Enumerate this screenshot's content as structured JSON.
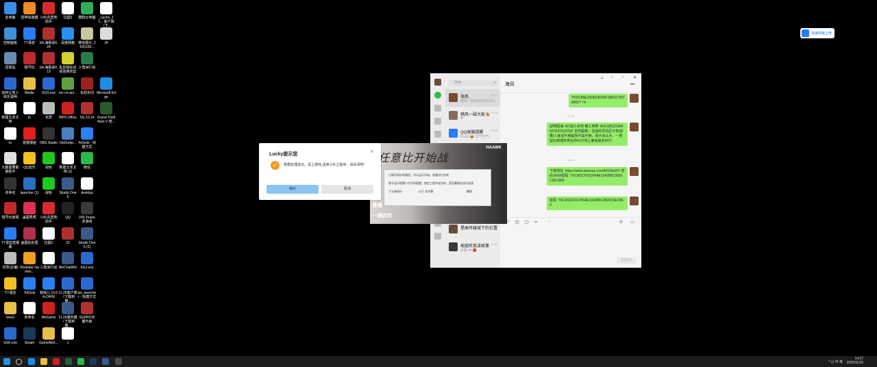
{
  "desktop_icons": [
    {
      "label": "此电脑",
      "color": "#3a8ee6"
    },
    {
      "label": "雷神加速器",
      "color": "#f08a24"
    },
    {
      "label": "小红花营地助手",
      "color": "#d92b2b"
    },
    {
      "label": "拉圆2",
      "color": "#ffffff"
    },
    {
      "label": "酷狗云电脑",
      "color": "#2fae5a"
    },
    {
      "label": "_cache_11... 客户端（下...",
      "color": "#ffffff"
    },
    {
      "label": "控制面板",
      "color": "#3d8fd6"
    },
    {
      "label": "TT语音",
      "color": "#2a7cf7"
    },
    {
      "label": "SA.海报桌6.24",
      "color": "#b03030"
    },
    {
      "label": "百度网盘",
      "color": "#2a90f0"
    },
    {
      "label": "微信图片_2025100...",
      "color": "#c8c8a0"
    },
    {
      "label": "JK",
      "color": "#dddddd"
    },
    {
      "label": "回收站",
      "color": "#6a8bb0"
    },
    {
      "label": "租号玩",
      "color": "#c02a2a"
    },
    {
      "label": "SA.海报桌6.19",
      "color": "#b03030"
    },
    {
      "label": "乱剪辑钻出体验果的剪",
      "color": "#d0d030"
    },
    {
      "label": "三角洲行动",
      "color": "#2a7a4a"
    },
    {
      "label": "如何让男人快乐说明",
      "color": "#2a6ad0"
    },
    {
      "label": "Media",
      "color": "#e8c048"
    },
    {
      "label": "SGS.exe",
      "color": "#2a6ad0"
    },
    {
      "label": "toc-cn-act...",
      "color": "#60a040"
    },
    {
      "label": "永劫无间",
      "color": "#a02020"
    },
    {
      "label": "Microsoft Edge",
      "color": "#1d8de0"
    },
    {
      "label": "新建文本文档",
      "color": "#ffffff"
    },
    {
      "label": "to",
      "color": "#ffffff"
    },
    {
      "label": "花草",
      "color": "#bbbbbb"
    },
    {
      "label": "WPS Office",
      "color": "#d02020"
    },
    {
      "label": "SU-10.14",
      "color": "#b03030"
    },
    {
      "label": "Grand Theft Auto V 增...",
      "color": "#2a5a2a"
    },
    {
      "label": "to",
      "color": "#ffffff"
    },
    {
      "label": "雷霆傳遊",
      "color": "#e02020"
    },
    {
      "label": "OBS Studio",
      "color": "#333333"
    },
    {
      "label": "GbDump...",
      "color": "#4a80c0"
    },
    {
      "label": "ToDesk - 快捷方式",
      "color": "#2a80f0"
    },
    {
      "label": "九趣需要勤勉助手",
      "color": "#e0e0e0"
    },
    {
      "label": "QQ音乐",
      "color": "#f0c020"
    },
    {
      "label": "绿色",
      "color": "#1ec81e"
    },
    {
      "label": "新建文本文档 (2)",
      "color": "#ffffff"
    },
    {
      "label": "微信",
      "color": "#2cb84c"
    },
    {
      "label": "未命名",
      "color": "#333333"
    },
    {
      "label": "launcher (1)",
      "color": "#2a70c0"
    },
    {
      "label": "绿色",
      "color": "#1ec81e"
    },
    {
      "label": "Studio One 6",
      "color": "#3a5a8a"
    },
    {
      "label": "desktop",
      "color": "#ffffff"
    },
    {
      "label": "租号玩家网",
      "color": "#c02a2a"
    },
    {
      "label": "盖图秀秀",
      "color": "#e03050"
    },
    {
      "label": "小红花营地助手",
      "color": "#d92b2b"
    },
    {
      "label": "QQ",
      "color": "#222222"
    },
    {
      "label": "240 2nano 贵游戏",
      "color": "#3a3a3a"
    },
    {
      "label": "TT语音直播版",
      "color": "#2a7cf7"
    },
    {
      "label": "盖图批处理",
      "color": "#b03050"
    },
    {
      "label": "拉圆1",
      "color": "#ffffff"
    },
    {
      "label": "22",
      "color": "#b03030"
    },
    {
      "label": "Studio One 6 (2)",
      "color": "#3a5a8a"
    },
    {
      "label": "花草(企编)",
      "color": "#bbbbbb"
    },
    {
      "label": "Rockstar Games...",
      "color": "#f0a020"
    },
    {
      "label": "三角洲行动",
      "color": "#ffffff"
    },
    {
      "label": "WeChatWin",
      "color": "#3a5a8a"
    },
    {
      "label": "SGJ.exe",
      "color": "#2a6ad0"
    },
    {
      "label": "YY语音",
      "color": "#f0c020"
    },
    {
      "label": "ToDesk",
      "color": "#2a80f0"
    },
    {
      "label": "锁钱儿 10.5A-DWM",
      "color": "#2a80f0"
    },
    {
      "label": "11.26客户端（下载到器...",
      "color": "#2a6ad0"
    },
    {
      "label": "ws_launcher - 快捷方式",
      "color": "#2a6ad0"
    },
    {
      "label": "wsed",
      "color": "#e8c048"
    },
    {
      "label": "未命名",
      "color": "#ffffff"
    },
    {
      "label": "WeGame",
      "color": "#d02020"
    },
    {
      "label": "11.26服务器（下载到器...",
      "color": "#3a5a8a"
    },
    {
      "label": "SGPRO天翼升级",
      "color": "#b03030"
    },
    {
      "label": "SGK.exe",
      "color": "#2a6ad0"
    },
    {
      "label": "Steam",
      "color": "#1a3a5a"
    },
    {
      "label": "GameAid1...",
      "color": "#e8c048"
    },
    {
      "label": "1",
      "color": "#ffffff"
    }
  ],
  "cloud_button": {
    "label": "加速安装上传"
  },
  "chat": {
    "search_placeholder": "搜索",
    "plus": "+",
    "active_title": "海风",
    "window_controls": [
      "⎯",
      "▫",
      "✕",
      "⊞"
    ],
    "more": "•••",
    "conversations": [
      {
        "name": "海风",
        "preview": "密码: TKCASCF021H...",
        "time": "14:14",
        "color": "#7a4a2a",
        "selected": true
      },
      {
        "name": "踏风一磁大能🐐",
        "preview": "❤",
        "time": "14:06",
        "color": "#8a6a5a"
      },
      {
        "name": "QQ邮箱提醒",
        "preview": "Foodi 📦 元气元气...",
        "time": "13:56",
        "color": "#2a7cf7"
      },
      {
        "name": "桌面传文件助手",
        "preview": "",
        "time": "",
        "color": "#2a5a2a"
      },
      {
        "name": "星曲传媒城下的位置",
        "preview": "",
        "time": "",
        "color": "#6a4a3a"
      },
      {
        "name": "故庭听我讲故事",
        "preview": "[2条] ❤ 🔴",
        "time": "14:01",
        "color": "#3a3a3a"
      }
    ],
    "messages": [
      {
        "text": "TKDC86E10DED5045F18041735784027 74"
      },
      {
        "text": "@明昭海: M7战斗术地 横火地带 -6HLGBQC00N547E5OQ32QF 自然超格，在别的评论区分享[如果]人家说不用提而不如不用，而不会认为，一类型比做理体类在你43万地上雇就最多50万"
      },
      {
        "text": "下载地址: https://www.lanzoue.com/b016ke9Tr 密码:6666密码: TKCASCF021HFAE104286C0820C5EC869"
      },
      {
        "text": "密码: TKCASCF021HFAE104286C0820C5EC869"
      }
    ],
    "timestamps": [
      "11:06",
      "14:14"
    ],
    "send_label": "发送(S)"
  },
  "game": {
    "calligraphy": "任意比开始战",
    "logo": "HAAWK",
    "menu": [
      "数据",
      "一键启攻"
    ],
    "subdialog": [
      "已填写保存的路径，可以运行开始，准备进行合成",
      "指令运行框需二代代码配置，指定工程中成功的，是否删除在进行处理",
      "下方调进价",
      "位于 本步骤",
      "删除"
    ]
  },
  "lucky": {
    "title": "Lucky提示您",
    "message": "数据处理成功，请上游戏,请用小红之程序，请关闭吧!",
    "ok": "确定",
    "cancel": "取消",
    "close": "✕",
    "check": "✓"
  },
  "taskbar": {
    "time": "14:27",
    "date": "2025/11/26",
    "tray": "^ ⊡ 中 英"
  }
}
